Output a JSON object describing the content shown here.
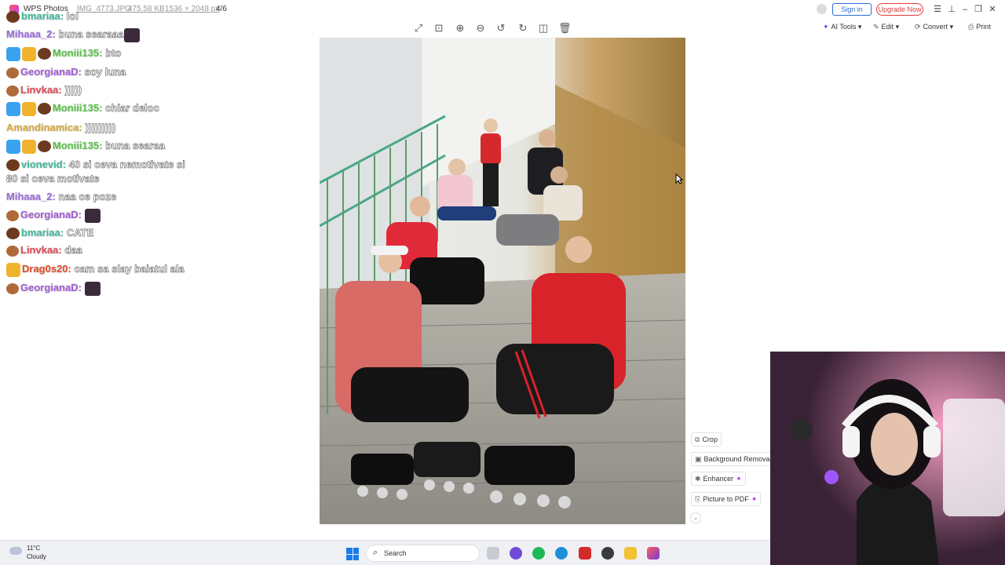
{
  "titlebar": {
    "app_name": "WPS Photos",
    "file_name": "IMG_4773.JPG",
    "file_size": "475.58 KB",
    "dimensions": "1536 × 2048 px",
    "position": "4/6",
    "sign_in": "Sign in",
    "upgrade": "Upgrade Now"
  },
  "toolbar_right": {
    "ai_tools": "AI Tools",
    "edit": "Edit",
    "convert": "Convert",
    "print": "Print"
  },
  "chat": [
    {
      "user": "bmariaa:",
      "text": "lol",
      "user_color": "#3fb89a",
      "badges": [
        "bean"
      ]
    },
    {
      "user": "Mihaaa_2:",
      "text": "buna searaaa",
      "user_color": "#9b6ad8",
      "badges": [],
      "emote": true
    },
    {
      "user": "Moniii135:",
      "text": "bto",
      "user_color": "#5cc24b",
      "badges": [
        "blue",
        "gold",
        "bean"
      ]
    },
    {
      "user": "GeorgianaD:",
      "text": "soy luna",
      "user_color": "#a35ad6",
      "badges": [
        "cup"
      ]
    },
    {
      "user": "Linvkaa:",
      "text": ")))))",
      "user_color": "#e04a5a",
      "badges": [
        "cup"
      ]
    },
    {
      "user": "Moniii135:",
      "text": "chiar deloc",
      "user_color": "#5cc24b",
      "badges": [
        "blue",
        "gold",
        "bean"
      ]
    },
    {
      "user": "Amandinamica:",
      "text": ")))))))))",
      "user_color": "#d6a93a",
      "badges": []
    },
    {
      "user": "Moniii135:",
      "text": "buna searaa",
      "user_color": "#5cc24b",
      "badges": [
        "blue",
        "gold",
        "bean"
      ]
    },
    {
      "user": "vionevid:",
      "text": "40 si ceva nemotivate si",
      "user_color": "#3fb89a",
      "badges": [
        "bean"
      ]
    },
    {
      "user": "",
      "text": "80 si ceva motivate",
      "user_color": "#ffffff",
      "badges": []
    },
    {
      "user": "Mihaaa_2:",
      "text": "naa ce poze",
      "user_color": "#9b6ad8",
      "badges": []
    },
    {
      "user": "GeorgianaD:",
      "text": "",
      "user_color": "#a35ad6",
      "badges": [
        "cup"
      ],
      "emote": true
    },
    {
      "user": "bmariaa:",
      "text": "CATE",
      "user_color": "#3fb89a",
      "badges": [
        "bean"
      ]
    },
    {
      "user": "Linvkaa:",
      "text": "daa",
      "user_color": "#e04a5a",
      "badges": [
        "cup"
      ]
    },
    {
      "user": "Drag0s20:",
      "text": "cam sa slay baiatul ala",
      "user_color": "#e04a2a",
      "badges": [
        "gold"
      ]
    },
    {
      "user": "GeorgianaD:",
      "text": "",
      "user_color": "#a35ad6",
      "badges": [
        "cup"
      ],
      "emote": true
    }
  ],
  "side_tools": {
    "crop": "Crop",
    "background_removal": "Background Removal",
    "enhancer": "Enhancer",
    "picture_to_pdf": "Picture to PDF"
  },
  "taskbar": {
    "temperature": "11°C",
    "weather": "Cloudy",
    "search": "Search"
  }
}
